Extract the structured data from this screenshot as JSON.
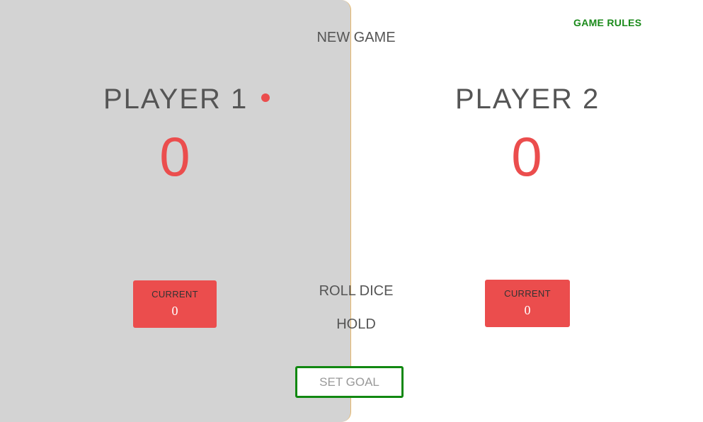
{
  "header": {
    "new_game_label": "NEW GAME",
    "rules_label": "GAME RULES"
  },
  "players": [
    {
      "name": "PLAYER 1",
      "score": "0",
      "current_label": "CURRENT",
      "current_value": "0",
      "active": true
    },
    {
      "name": "PLAYER 2",
      "score": "0",
      "current_label": "CURRENT",
      "current_value": "0",
      "active": false
    }
  ],
  "controls": {
    "roll_label": "ROLL DICE",
    "hold_label": "HOLD",
    "goal_placeholder": "SET GOAL"
  },
  "colors": {
    "accent": "#eb4d4d",
    "active_panel": "#d3d3d3",
    "rules_link": "#1a8a1a",
    "goal_border": "#118811"
  }
}
